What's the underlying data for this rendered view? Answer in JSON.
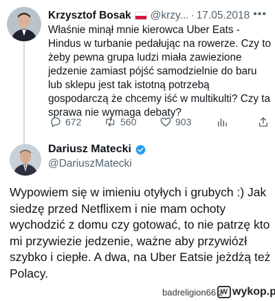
{
  "tweet1": {
    "author_name": "Krzysztof Bosak",
    "handle": "@krzy...",
    "separator": "·",
    "date": "17.05.2018",
    "more_icon": "more-horizontal-icon",
    "text": "Właśnie minął mnie kierowca Uber Eats - Hindus w turbanie pedałując na rowerze. Czy to żeby pewna grupa ludzi miała zawiezione jedzenie zamiast pójść samodzielnie do baru lub sklepu jest tak istotną potrzebą gospodarczą że chcemy iść w multikulti? Czy ta sprawa nie wymaga debaty?",
    "actions": {
      "replies": "672",
      "retweets": "560",
      "likes": "903"
    }
  },
  "tweet2": {
    "author_name": "Dariusz Matecki",
    "handle": "@DariuszMatecki",
    "text": "Wypowiem się w imieniu otyłych i grubych :) Jak siedzę przed Netflixem i nie mam ochoty wychodzić z domu czy gotować, to nie patrzę kto mi przywiezie jedzenie, ważne aby przywiózł szybko i ciepłe. A dwa, na Uber Eatsie jeżdżą też Polacy."
  },
  "footer": {
    "uploader": "badreligion66",
    "separator": "z",
    "logo_text": "wykop.pl",
    "logo_mark": "W"
  },
  "colors": {
    "text": "#0f1419",
    "secondary": "#536471",
    "verified": "#1d9bf0",
    "thread_line": "#cfd9de"
  }
}
